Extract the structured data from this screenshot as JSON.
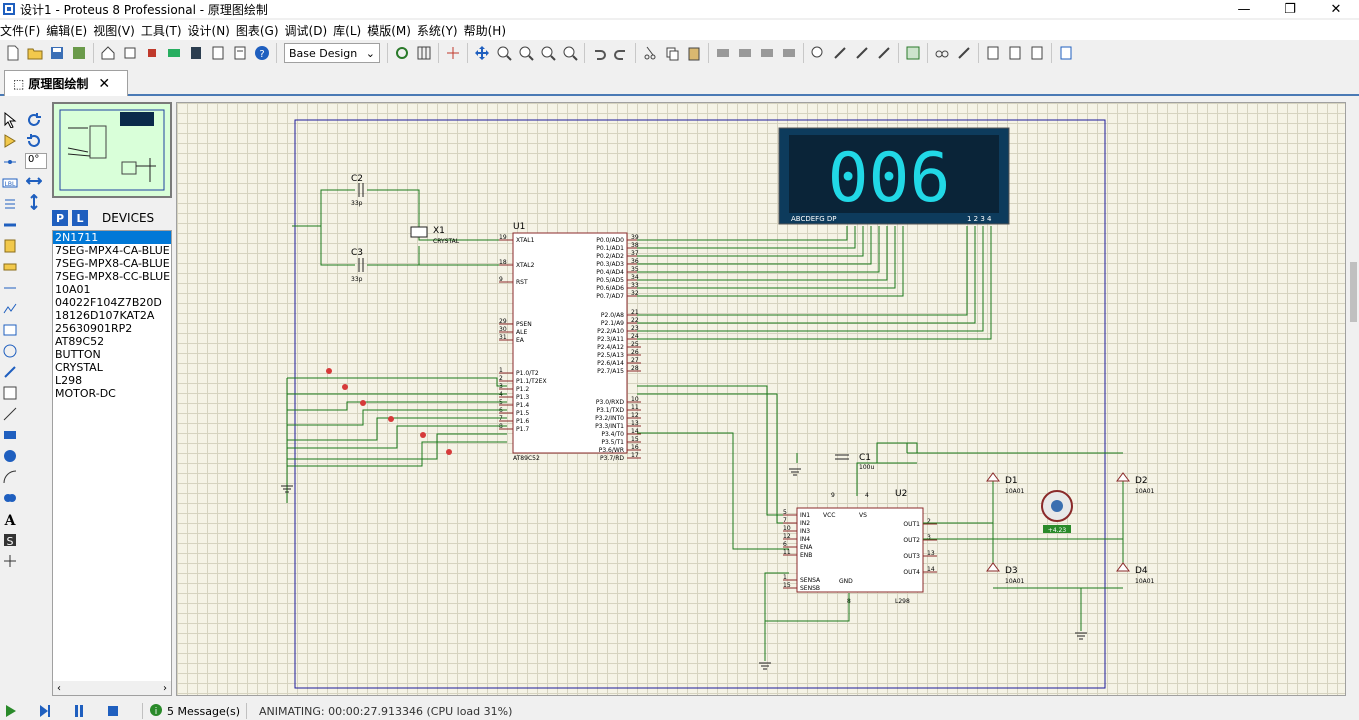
{
  "window": {
    "title": "设计1 - Proteus 8 Professional - 原理图绘制"
  },
  "menu": [
    "文件(F)",
    "编辑(E)",
    "视图(V)",
    "工具(T)",
    "设计(N)",
    "图表(G)",
    "调试(D)",
    "库(L)",
    "模版(M)",
    "系统(Y)",
    "帮助(H)"
  ],
  "toolbar": {
    "design_select": "Base Design"
  },
  "tab": {
    "label": "原理图绘制"
  },
  "left": {
    "rotation_value": "0°"
  },
  "devices": {
    "title": "DEVICES",
    "p_label": "P",
    "l_label": "L",
    "items": [
      "2N1711",
      "7SEG-MPX4-CA-BLUE",
      "7SEG-MPX8-CA-BLUE",
      "7SEG-MPX8-CC-BLUE",
      "10A01",
      "04022F104Z7B20D",
      "18126D107KAT2A",
      "25630901RP2",
      "AT89C52",
      "BUTTON",
      "CRYSTAL",
      "L298",
      "MOTOR-DC"
    ]
  },
  "schematic": {
    "display_digits": "006",
    "display_seg_label": "ABCDEFG  DP",
    "display_digit_label": "1 2 3 4",
    "u1_ref": "U1",
    "u1_part": "AT89C52",
    "u2_ref": "U2",
    "u2_part": "L298",
    "x1_ref": "X1",
    "x1_part": "CRYSTAL",
    "c1_ref": "C1",
    "c1_val": "100u",
    "c2_ref": "C2",
    "c2_val": "33p",
    "c3_ref": "C3",
    "c3_val": "33p",
    "d1_ref": "D1",
    "d2_ref": "D2",
    "d3_ref": "D3",
    "d4_ref": "D4",
    "diode_part": "10A01",
    "motor_value": "+4.23",
    "u1_left_pins": [
      {
        "num": "19",
        "name": "XTAL1"
      },
      {
        "num": "18",
        "name": "XTAL2"
      },
      {
        "num": "9",
        "name": "RST"
      },
      {
        "num": "29",
        "name": "PSEN"
      },
      {
        "num": "30",
        "name": "ALE"
      },
      {
        "num": "31",
        "name": "EA"
      },
      {
        "num": "1",
        "name": "P1.0/T2"
      },
      {
        "num": "2",
        "name": "P1.1/T2EX"
      },
      {
        "num": "3",
        "name": "P1.2"
      },
      {
        "num": "4",
        "name": "P1.3"
      },
      {
        "num": "5",
        "name": "P1.4"
      },
      {
        "num": "6",
        "name": "P1.5"
      },
      {
        "num": "7",
        "name": "P1.6"
      },
      {
        "num": "8",
        "name": "P1.7"
      }
    ],
    "u1_right_pins": [
      {
        "num": "39",
        "name": "P0.0/AD0"
      },
      {
        "num": "38",
        "name": "P0.1/AD1"
      },
      {
        "num": "37",
        "name": "P0.2/AD2"
      },
      {
        "num": "36",
        "name": "P0.3/AD3"
      },
      {
        "num": "35",
        "name": "P0.4/AD4"
      },
      {
        "num": "34",
        "name": "P0.5/AD5"
      },
      {
        "num": "33",
        "name": "P0.6/AD6"
      },
      {
        "num": "32",
        "name": "P0.7/AD7"
      },
      {
        "num": "21",
        "name": "P2.0/A8"
      },
      {
        "num": "22",
        "name": "P2.1/A9"
      },
      {
        "num": "23",
        "name": "P2.2/A10"
      },
      {
        "num": "24",
        "name": "P2.3/A11"
      },
      {
        "num": "25",
        "name": "P2.4/A12"
      },
      {
        "num": "26",
        "name": "P2.5/A13"
      },
      {
        "num": "27",
        "name": "P2.6/A14"
      },
      {
        "num": "28",
        "name": "P2.7/A15"
      },
      {
        "num": "10",
        "name": "P3.0/RXD"
      },
      {
        "num": "11",
        "name": "P3.1/TXD"
      },
      {
        "num": "12",
        "name": "P3.2/INT0"
      },
      {
        "num": "13",
        "name": "P3.3/INT1"
      },
      {
        "num": "14",
        "name": "P3.4/T0"
      },
      {
        "num": "15",
        "name": "P3.5/T1"
      },
      {
        "num": "16",
        "name": "P3.6/WR"
      },
      {
        "num": "17",
        "name": "P3.7/RD"
      }
    ],
    "u2_left_pins": [
      {
        "num": "5",
        "name": "IN1"
      },
      {
        "num": "7",
        "name": "IN2"
      },
      {
        "num": "10",
        "name": "IN3"
      },
      {
        "num": "12",
        "name": "IN4"
      },
      {
        "num": "6",
        "name": "ENA"
      },
      {
        "num": "11",
        "name": "ENB"
      },
      {
        "num": "1",
        "name": "SENSA"
      },
      {
        "num": "15",
        "name": "SENSB"
      }
    ],
    "u2_right_pins": [
      {
        "num": "2",
        "name": "OUT1"
      },
      {
        "num": "3",
        "name": "OUT2"
      },
      {
        "num": "13",
        "name": "OUT3"
      },
      {
        "num": "14",
        "name": "OUT4"
      }
    ],
    "u2_vcc": "VCC",
    "u2_vs": "VS",
    "u2_gnd": "GND",
    "u2_pin9": "9",
    "u2_pin4": "4",
    "u2_pin8": "8"
  },
  "status": {
    "messages": "5 Message(s)",
    "animating": "ANIMATING: 00:00:27.913346 (CPU load 31%)"
  }
}
